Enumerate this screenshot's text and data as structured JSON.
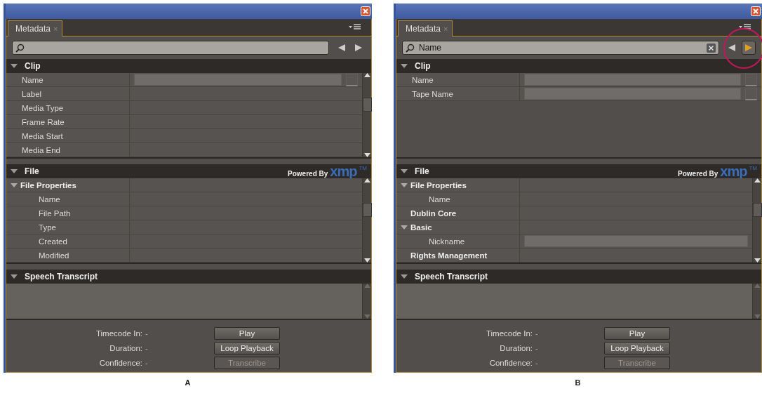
{
  "panels": [
    {
      "caption": "A",
      "tab": {
        "label": "Metadata",
        "close": "×"
      },
      "search": {
        "clearable": false
      },
      "nav": {
        "next_active": false,
        "callout": false
      },
      "sections": [
        {
          "title": "Clip",
          "expanded": true,
          "scrollable": true,
          "rows": [
            {
              "label": "Name",
              "field": true,
              "side_button": true
            },
            {
              "label": "Label",
              "field": false
            },
            {
              "label": "Media Type",
              "field": false
            },
            {
              "label": "Frame Rate",
              "field": false
            },
            {
              "label": "Media Start",
              "field": false
            },
            {
              "label": "Media End",
              "field": false
            }
          ]
        },
        {
          "title": "File",
          "expanded": true,
          "scrollable": true,
          "logo": {
            "prefix": "Powered By",
            "mark": "xmp",
            "tm": "TM"
          },
          "rows": [
            {
              "label": "File Properties",
              "group": true,
              "expanded": true,
              "children": [
                {
                  "label": "Name",
                  "field": false
                },
                {
                  "label": "File Path",
                  "field": false
                },
                {
                  "label": "Type",
                  "field": false
                },
                {
                  "label": "Created",
                  "field": false
                },
                {
                  "label": "Modified",
                  "field": false
                }
              ]
            }
          ]
        },
        {
          "title": "Speech Transcript",
          "expanded": true,
          "scrollable": true,
          "kind": "transcript"
        }
      ],
      "readouts": [
        {
          "label": "Timecode In:",
          "value": "-"
        },
        {
          "label": "Duration:",
          "value": "-"
        },
        {
          "label": "Confidence:",
          "value": "-"
        }
      ],
      "buttons": [
        {
          "label": "Play",
          "disabled": false
        },
        {
          "label": "Loop Playback",
          "disabled": false
        },
        {
          "label": "Transcribe",
          "disabled": true
        }
      ]
    },
    {
      "caption": "B",
      "tab": {
        "label": "Metadata",
        "close": "×"
      },
      "search": {
        "value": "Name",
        "clearable": true
      },
      "nav": {
        "next_active": true,
        "callout": true
      },
      "sections": [
        {
          "title": "Clip",
          "expanded": true,
          "scrollable": false,
          "rows": [
            {
              "label": "Name",
              "field": true,
              "side_button": true
            },
            {
              "label": "Tape Name",
              "field": true,
              "side_button": true
            }
          ]
        },
        {
          "title": "File",
          "expanded": true,
          "scrollable": true,
          "logo": {
            "prefix": "Powered By",
            "mark": "xmp",
            "tm": "TM"
          },
          "rows": [
            {
              "label": "File Properties",
              "group": true,
              "expanded": true,
              "children": [
                {
                  "label": "Name",
                  "field": false
                }
              ]
            },
            {
              "label": "Dublin Core",
              "group": true,
              "expanded": false
            },
            {
              "label": "Basic",
              "group": true,
              "expanded": true,
              "children": [
                {
                  "label": "Nickname",
                  "field": true,
                  "side_button": false
                }
              ]
            },
            {
              "label": "Rights Management",
              "group": true,
              "expanded": false
            }
          ]
        },
        {
          "title": "Speech Transcript",
          "expanded": true,
          "scrollable": true,
          "kind": "transcript"
        }
      ],
      "readouts": [
        {
          "label": "Timecode In:",
          "value": "-"
        },
        {
          "label": "Duration:",
          "value": "-"
        },
        {
          "label": "Confidence:",
          "value": "-"
        }
      ],
      "buttons": [
        {
          "label": "Play",
          "disabled": false
        },
        {
          "label": "Loop Playback",
          "disabled": false
        },
        {
          "label": "Transcribe",
          "disabled": true
        }
      ]
    }
  ]
}
